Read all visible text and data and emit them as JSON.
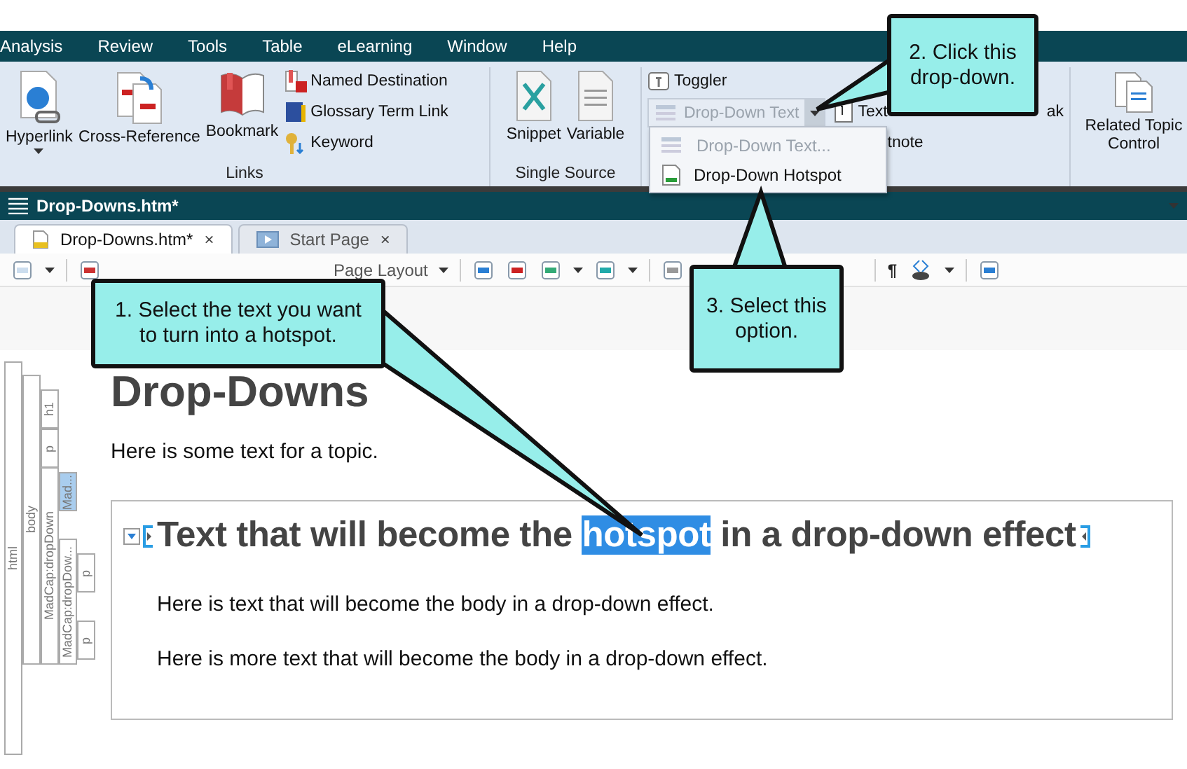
{
  "menu_bar": [
    {
      "label": "Analysis"
    },
    {
      "label": "Review"
    },
    {
      "label": "Tools"
    },
    {
      "label": "Table"
    },
    {
      "label": "eLearning"
    },
    {
      "label": "Window"
    },
    {
      "label": "Help"
    }
  ],
  "ribbon": {
    "links": {
      "label": "Links",
      "large_buttons": [
        "Hyperlink",
        "Cross-Reference",
        "Bookmark"
      ],
      "small_buttons": [
        "Named Destination",
        "Glossary Term Link",
        "Keyword"
      ]
    },
    "single_source": {
      "label": "Single Source",
      "large_buttons": [
        "Snippet",
        "Variable"
      ]
    },
    "toggler": "Toggler",
    "drop_down_text": {
      "label": "Drop-Down Text",
      "disabled": true
    },
    "text_box": "Text",
    "footnote_fragment": "tnote",
    "break_fragment": "ak",
    "related": {
      "line_1": "Related Topic",
      "line_2": "Control"
    }
  },
  "drop_down_menu": [
    {
      "label": "Drop-Down Text...",
      "disabled": true
    },
    {
      "label": "Drop-Down Hotspot",
      "disabled": false
    }
  ],
  "document_title": "Drop-Downs.htm*",
  "tabs": [
    {
      "label": "Drop-Downs.htm*",
      "selected": true,
      "close": "×"
    },
    {
      "label": "Start Page",
      "selected": false,
      "close": "×"
    }
  ],
  "toolbar": {
    "layout_dropdown": "Page Layout",
    "pilcrow": "¶"
  },
  "structure_bar": {
    "label": "html",
    "selected": false,
    "children": [
      {
        "label": "body",
        "selected": false,
        "children": [
          {
            "label": "h1",
            "selected": false
          },
          {
            "label": "p",
            "selected": false
          },
          {
            "label": "MadCap:dropDown",
            "selected": false,
            "children": [
              {
                "label": "Mad...",
                "selected": true
              },
              {
                "label": "MadCap:dropDow...",
                "selected": false,
                "children": [
                  {
                    "label": "p",
                    "selected": false
                  },
                  {
                    "label": "p",
                    "selected": false
                  }
                ]
              }
            ]
          }
        ]
      }
    ]
  },
  "document": {
    "heading": "Drop-Downs",
    "paragraph": "Here is some text for a topic.",
    "drop_down": {
      "head_before": "Text that will become the ",
      "head_selected": "hotspot",
      "head_after": " in a drop-down effect",
      "body": [
        "Here is text that will become the body in a drop-down effect.",
        "Here is more text that will become the body in a drop-down effect."
      ]
    }
  },
  "callouts": [
    {
      "text": "1. Select the text you want to turn into a hotspot."
    },
    {
      "text": "2. Click this drop-down."
    },
    {
      "text": "3. Select this option."
    }
  ]
}
